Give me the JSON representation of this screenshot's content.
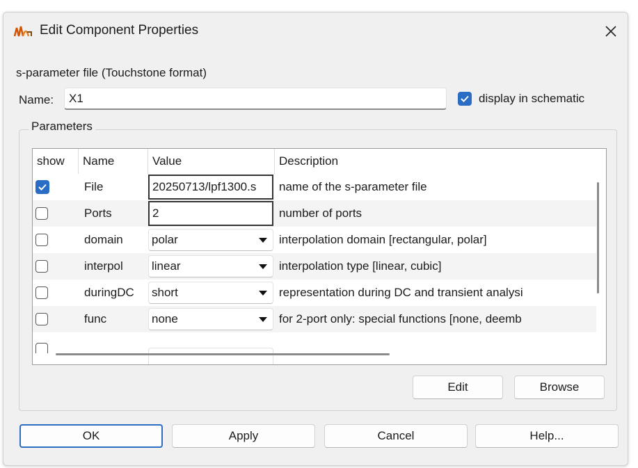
{
  "window": {
    "title": "Edit Component Properties",
    "icon": "app-icon",
    "close_icon": "close-icon"
  },
  "component": {
    "description": "s-parameter file (Touchstone format)",
    "name_label": "Name:",
    "name_value": "X1",
    "display_label": "display in schematic",
    "display_checked": true
  },
  "parameters": {
    "group_label": "Parameters",
    "headers": {
      "show": "show",
      "name": "Name",
      "value": "Value",
      "description": "Description"
    },
    "rows": [
      {
        "show": true,
        "name": "File",
        "value": "20250713/lpf1300.s",
        "description": "name of the s-parameter file"
      },
      {
        "show": false,
        "name": "Ports",
        "value": "2",
        "description": "number of ports"
      },
      {
        "show": false,
        "name": "domain",
        "value": "polar",
        "description": "interpolation domain [rectangular, polar]"
      },
      {
        "show": false,
        "name": "interpol",
        "value": "linear",
        "description": "interpolation type [linear, cubic]"
      },
      {
        "show": false,
        "name": "duringDC",
        "value": "short",
        "description": "representation during DC and transient analysi"
      },
      {
        "show": false,
        "name": "func",
        "value": "none",
        "description": "for 2-port only: special functions [none, deemb"
      }
    ],
    "edit_button": "Edit",
    "browse_button": "Browse"
  },
  "buttons": {
    "ok": "OK",
    "apply": "Apply",
    "cancel": "Cancel",
    "help": "Help..."
  },
  "colors": {
    "accent": "#2b6cc4",
    "window_bg": "#f0f0f0"
  }
}
